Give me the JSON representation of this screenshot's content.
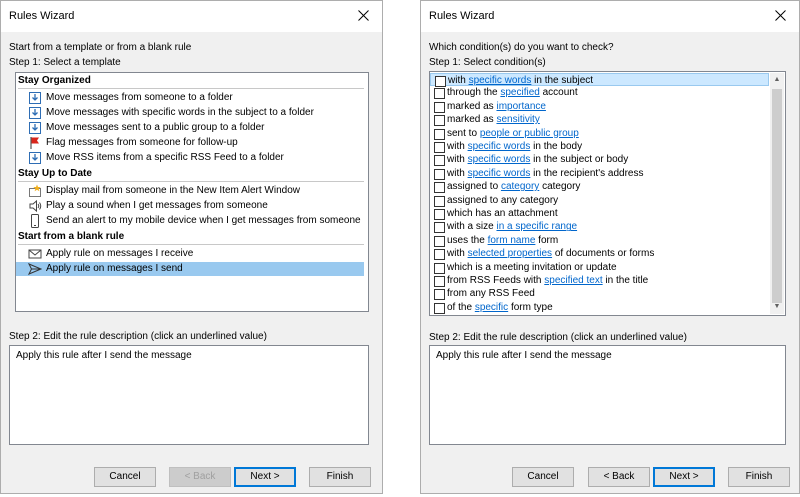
{
  "left": {
    "title": "Rules Wizard",
    "intro": "Start from a template or from a blank rule",
    "step1": "Step 1: Select a template",
    "groups": [
      {
        "header": "Stay Organized",
        "items": [
          {
            "icon": "move-folder-icon",
            "label": "Move messages from someone to a folder"
          },
          {
            "icon": "move-folder-icon",
            "label": "Move messages with specific words in the subject to a folder"
          },
          {
            "icon": "move-folder-icon",
            "label": "Move messages sent to a public group to a folder"
          },
          {
            "icon": "red-flag-icon",
            "label": "Flag messages from someone for follow-up"
          },
          {
            "icon": "move-folder-icon",
            "label": "Move RSS items from a specific RSS Feed to a folder"
          }
        ]
      },
      {
        "header": "Stay Up to Date",
        "items": [
          {
            "icon": "alert-window-icon",
            "label": "Display mail from someone in the New Item Alert Window"
          },
          {
            "icon": "speaker-icon",
            "label": "Play a sound when I get messages from someone"
          },
          {
            "icon": "mobile-device-icon",
            "label": "Send an alert to my mobile device when I get messages from someone"
          }
        ]
      },
      {
        "header": "Start from a blank rule",
        "items": [
          {
            "icon": "envelope-icon",
            "label": "Apply rule on messages I receive"
          },
          {
            "icon": "send-arrow-icon",
            "label": "Apply rule on messages I send"
          }
        ]
      }
    ],
    "step2": "Step 2: Edit the rule description (click an underlined value)",
    "description": "Apply this rule after I send the message",
    "buttons": {
      "cancel": "Cancel",
      "back": "< Back",
      "next": "Next >",
      "finish": "Finish"
    }
  },
  "right": {
    "title": "Rules Wizard",
    "question": "Which condition(s) do you want to check?",
    "step1": "Step 1: Select condition(s)",
    "conditions": [
      {
        "pre": "with ",
        "link": "specific words",
        "post": " in the subject"
      },
      {
        "pre": "through the ",
        "link": "specified",
        "post": " account"
      },
      {
        "pre": "marked as ",
        "link": "importance",
        "post": ""
      },
      {
        "pre": "marked as ",
        "link": "sensitivity",
        "post": ""
      },
      {
        "pre": "sent to ",
        "link": "people or public group",
        "post": ""
      },
      {
        "pre": "with ",
        "link": "specific words",
        "post": " in the body"
      },
      {
        "pre": "with ",
        "link": "specific words",
        "post": " in the subject or body"
      },
      {
        "pre": "with ",
        "link": "specific words",
        "post": " in the recipient's address"
      },
      {
        "pre": "assigned to ",
        "link": "category",
        "post": " category"
      },
      {
        "pre": "assigned to any category",
        "link": "",
        "post": ""
      },
      {
        "pre": "which has an attachment",
        "link": "",
        "post": ""
      },
      {
        "pre": "with a size ",
        "link": "in a specific range",
        "post": ""
      },
      {
        "pre": "uses the ",
        "link": "form name",
        "post": " form"
      },
      {
        "pre": "with ",
        "link": "selected properties",
        "post": " of documents or forms"
      },
      {
        "pre": "which is a meeting invitation or update",
        "link": "",
        "post": ""
      },
      {
        "pre": "from RSS Feeds with ",
        "link": "specified text",
        "post": " in the title"
      },
      {
        "pre": "from any RSS Feed",
        "link": "",
        "post": ""
      },
      {
        "pre": "of the ",
        "link": "specific",
        "post": " form type"
      }
    ],
    "step2": "Step 2: Edit the rule description (click an underlined value)",
    "description": "Apply this rule after I send the message",
    "buttons": {
      "cancel": "Cancel",
      "back": "< Back",
      "next": "Next >",
      "finish": "Finish"
    }
  }
}
